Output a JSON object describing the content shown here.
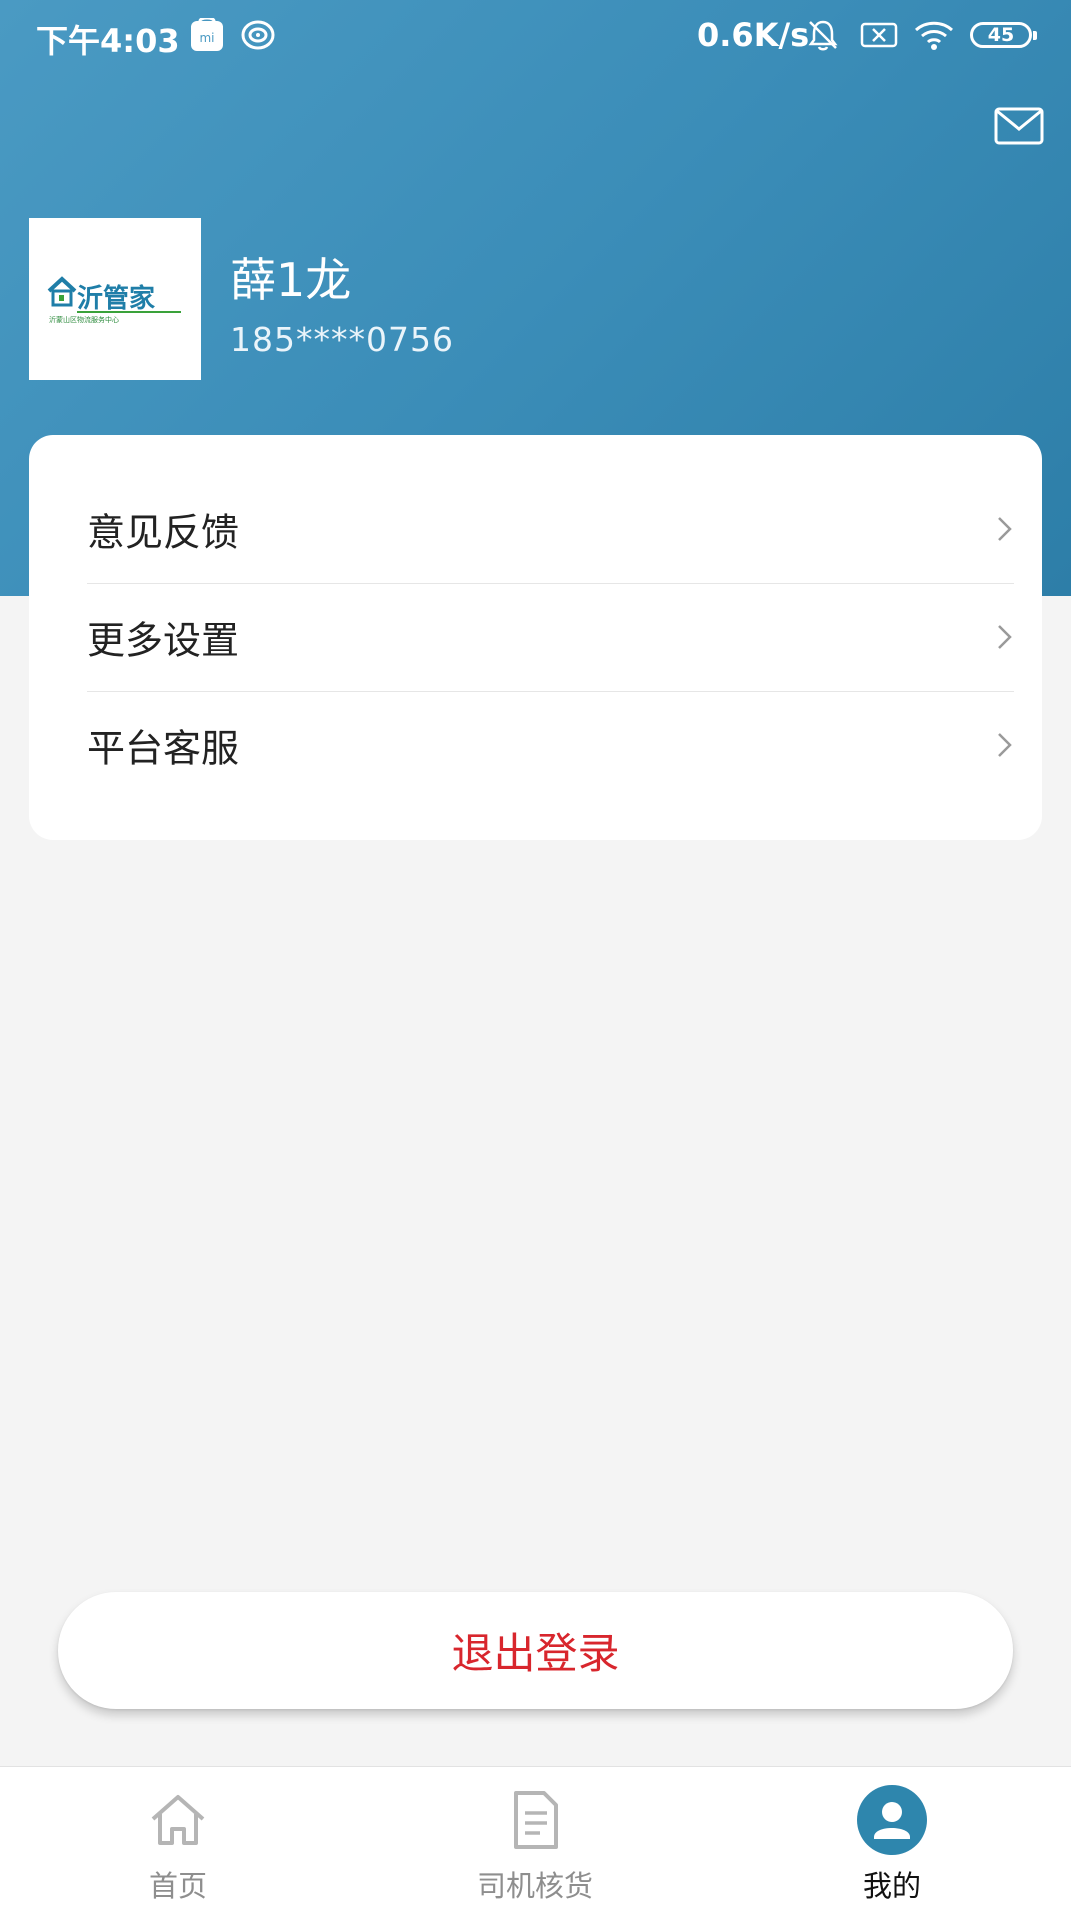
{
  "status_bar": {
    "time": "下午4:03",
    "network_speed": "0.6K/s",
    "battery": "45"
  },
  "profile": {
    "name": "薛1龙",
    "phone": "185****0756",
    "logo_text": "沂管家",
    "logo_subtext": "沂蒙山区物流服务中心"
  },
  "menu": {
    "items": [
      {
        "label": "意见反馈"
      },
      {
        "label": "更多设置"
      },
      {
        "label": "平台客服"
      }
    ]
  },
  "logout": {
    "label": "退出登录"
  },
  "tabbar": {
    "tabs": [
      {
        "label": "首页",
        "icon": "home-icon",
        "active": false
      },
      {
        "label": "司机核货",
        "icon": "document-icon",
        "active": false
      },
      {
        "label": "我的",
        "icon": "user-icon",
        "active": true
      }
    ]
  },
  "colors": {
    "header_start": "#4a9ac3",
    "header_end": "#2d7ea8",
    "logout_text": "#d8262d",
    "active_tab_icon": "#2e86ad"
  }
}
